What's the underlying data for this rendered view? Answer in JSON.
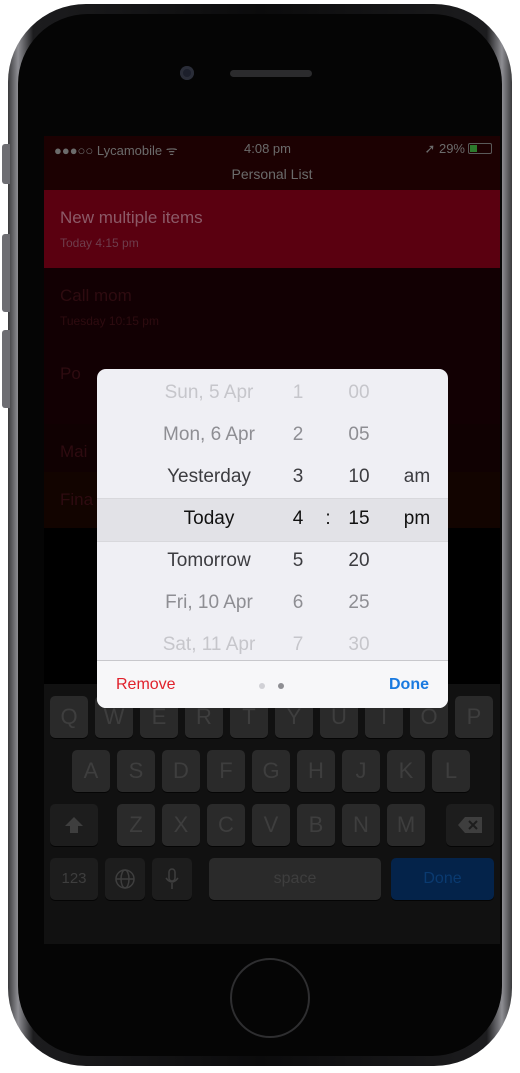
{
  "status_bar": {
    "carrier": "●●●○○ Lycamobile ᯤ",
    "time": "4:08 pm",
    "battery": "➚ 29%"
  },
  "nav": {
    "title": "Personal List"
  },
  "list": [
    {
      "title": "New multiple items",
      "subtitle": "Today 4:15 pm",
      "active": true
    },
    {
      "title": "Call mom",
      "subtitle": "Tuesday 10:15 pm",
      "active": false
    },
    {
      "title": "Po",
      "subtitle": "",
      "active": false
    },
    {
      "title": "Mai",
      "subtitle": "",
      "active": false
    },
    {
      "title": "Fina",
      "subtitle": "",
      "active": false
    }
  ],
  "picker": {
    "dates": [
      "Sun, 5 Apr",
      "Mon, 6 Apr",
      "Yesterday",
      "Today",
      "Tomorrow",
      "Fri, 10 Apr",
      "Sat, 11 Apr"
    ],
    "hours": [
      "1",
      "2",
      "3",
      "4",
      "5",
      "6",
      "7"
    ],
    "minutes": [
      "00",
      "05",
      "10",
      "15",
      "20",
      "25",
      "30"
    ],
    "separator": ":",
    "ampm": [
      "am",
      "pm"
    ],
    "remove_label": "Remove",
    "done_label": "Done",
    "page_dots": 2,
    "active_page": 2
  },
  "keyboard": {
    "row1": [
      "Q",
      "W",
      "E",
      "R",
      "T",
      "Y",
      "U",
      "I",
      "O",
      "P"
    ],
    "row2": [
      "A",
      "S",
      "D",
      "F",
      "G",
      "H",
      "J",
      "K",
      "L"
    ],
    "row3": [
      "Z",
      "X",
      "C",
      "V",
      "B",
      "N",
      "M"
    ],
    "numbers_label": "123",
    "space_label": "space",
    "done_label": "Done"
  },
  "colors": {
    "accent_blue": "#1a7ae0",
    "destructive_red": "#e0212c",
    "row_active": "#5a0010",
    "picker_bg": "#efeff4"
  }
}
